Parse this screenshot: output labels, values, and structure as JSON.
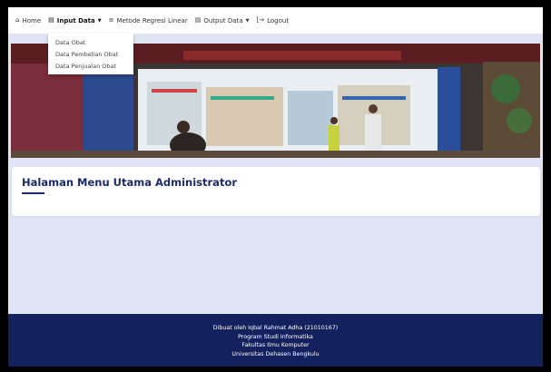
{
  "navbar": {
    "items": [
      {
        "label": "Home",
        "icon": "home-icon"
      },
      {
        "label": "Input Data",
        "icon": "database-icon",
        "dropdown": true
      },
      {
        "label": "Metode Regresi Linear",
        "icon": "chart-icon"
      },
      {
        "label": "Output Data",
        "icon": "database-icon",
        "dropdown": true
      },
      {
        "label": "Logout",
        "icon": "logout-icon"
      }
    ]
  },
  "dropdown": {
    "items": [
      "Data Obat",
      "Data Pembelian Obat",
      "Data Penjualan Obat"
    ]
  },
  "card": {
    "title": "Halaman Menu Utama Administrator"
  },
  "footer": {
    "lines": [
      "Dibuat oleh Iqbal Rahmat Adha (21010167)",
      "Program Studi Informatika",
      "Fakultas Ilmu Komputer",
      "Universitas Dehasen Bengkulu"
    ]
  },
  "colors": {
    "accent": "#1a2a6e",
    "footer_bg": "#14215f",
    "page_bg": "#dfe5f2"
  }
}
